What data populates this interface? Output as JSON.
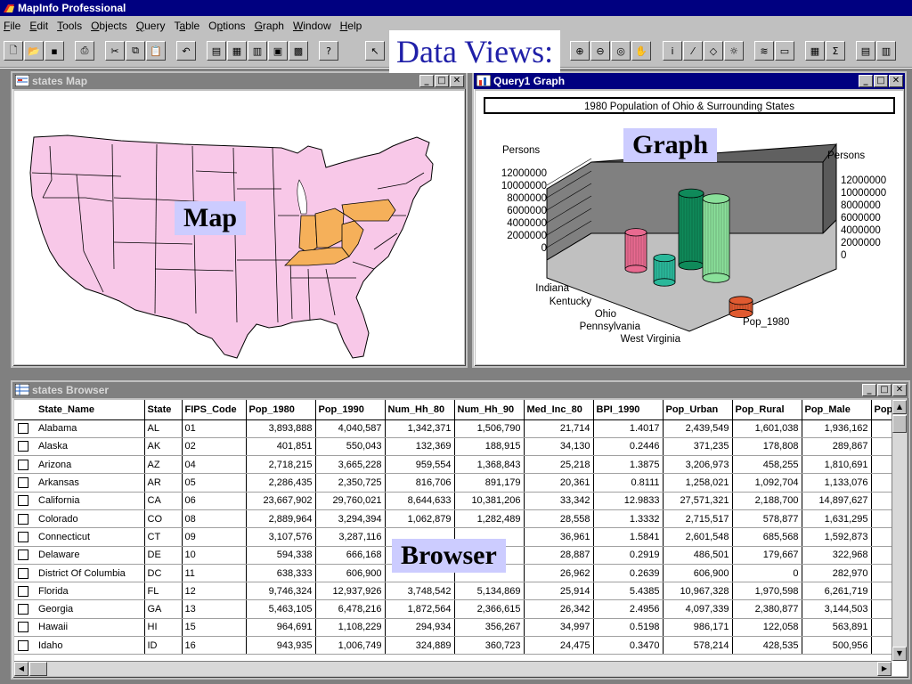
{
  "app": {
    "title": "MapInfo Professional"
  },
  "menu": [
    {
      "pre": "",
      "u": "F",
      "post": "ile"
    },
    {
      "pre": "",
      "u": "E",
      "post": "dit"
    },
    {
      "pre": "",
      "u": "T",
      "post": "ools"
    },
    {
      "pre": "",
      "u": "O",
      "post": "bjects"
    },
    {
      "pre": "",
      "u": "Q",
      "post": "uery"
    },
    {
      "pre": "T",
      "u": "a",
      "post": "ble"
    },
    {
      "pre": "O",
      "u": "p",
      "post": "tions"
    },
    {
      "pre": "",
      "u": "G",
      "post": "raph"
    },
    {
      "pre": "",
      "u": "W",
      "post": "indow"
    },
    {
      "pre": "",
      "u": "H",
      "post": "elp"
    }
  ],
  "callouts": {
    "title": "Data Views:",
    "map": "Map",
    "graph": "Graph",
    "browser": "Browser"
  },
  "map_window": {
    "title": "states Map",
    "highlight_color": "#f5b05a",
    "state_color": "#f8c8e8"
  },
  "graph_window": {
    "title": "Query1 Graph",
    "chart_data": {
      "type": "bar",
      "title": "1980 Population of Ohio & Surrounding States",
      "categories": [
        "Indiana",
        "Kentucky",
        "Ohio",
        "Pennsylvania",
        "West Virginia"
      ],
      "series": [
        {
          "name": "Pop_1980",
          "values": [
            5490224,
            3660777,
            10797630,
            11863895,
            1949644
          ]
        }
      ],
      "ylabel": "Persons",
      "ylim": [
        0,
        12000000
      ],
      "yticks": [
        "12000000",
        "10000000",
        "8000000",
        "6000000",
        "4000000",
        "2000000",
        "0"
      ],
      "colors": [
        "#e86a90",
        "#2ab89a",
        "#0f8a5a",
        "#8ae09a",
        "#e05a30"
      ],
      "bar_style": "3d-cylinder",
      "legend": "none"
    }
  },
  "browser": {
    "title": "states Browser",
    "columns": [
      "State_Name",
      "State",
      "FIPS_Code",
      "Pop_1980",
      "Pop_1990",
      "Num_Hh_80",
      "Num_Hh_90",
      "Med_Inc_80",
      "BPI_1990",
      "Pop_Urban",
      "Pop_Rural",
      "Pop_Male",
      "Pop"
    ],
    "rows": [
      [
        "Alabama",
        "AL",
        "01",
        "3,893,888",
        "4,040,587",
        "1,342,371",
        "1,506,790",
        "21,714",
        "1.4017",
        "2,439,549",
        "1,601,038",
        "1,936,162",
        ""
      ],
      [
        "Alaska",
        "AK",
        "02",
        "401,851",
        "550,043",
        "132,369",
        "188,915",
        "34,130",
        "0.2446",
        "371,235",
        "178,808",
        "289,867",
        ""
      ],
      [
        "Arizona",
        "AZ",
        "04",
        "2,718,215",
        "3,665,228",
        "959,554",
        "1,368,843",
        "25,218",
        "1.3875",
        "3,206,973",
        "458,255",
        "1,810,691",
        ""
      ],
      [
        "Arkansas",
        "AR",
        "05",
        "2,286,435",
        "2,350,725",
        "816,706",
        "891,179",
        "20,361",
        "0.8111",
        "1,258,021",
        "1,092,704",
        "1,133,076",
        ""
      ],
      [
        "California",
        "CA",
        "06",
        "23,667,902",
        "29,760,021",
        "8,644,633",
        "10,381,206",
        "33,342",
        "12.9833",
        "27,571,321",
        "2,188,700",
        "14,897,627",
        ""
      ],
      [
        "Colorado",
        "CO",
        "08",
        "2,889,964",
        "3,294,394",
        "1,062,879",
        "1,282,489",
        "28,558",
        "1.3332",
        "2,715,517",
        "578,877",
        "1,631,295",
        ""
      ],
      [
        "Connecticut",
        "CT",
        "09",
        "3,107,576",
        "3,287,116",
        "",
        "",
        "36,961",
        "1.5841",
        "2,601,548",
        "685,568",
        "1,592,873",
        ""
      ],
      [
        "Delaware",
        "DE",
        "10",
        "594,338",
        "666,168",
        "",
        "",
        "28,887",
        "0.2919",
        "486,501",
        "179,667",
        "322,968",
        ""
      ],
      [
        "District Of Columbia",
        "DC",
        "11",
        "638,333",
        "606,900",
        "",
        "",
        "26,962",
        "0.2639",
        "606,900",
        "0",
        "282,970",
        ""
      ],
      [
        "Florida",
        "FL",
        "12",
        "9,746,324",
        "12,937,926",
        "3,748,542",
        "5,134,869",
        "25,914",
        "5.4385",
        "10,967,328",
        "1,970,598",
        "6,261,719",
        ""
      ],
      [
        "Georgia",
        "GA",
        "13",
        "5,463,105",
        "6,478,216",
        "1,872,564",
        "2,366,615",
        "26,342",
        "2.4956",
        "4,097,339",
        "2,380,877",
        "3,144,503",
        ""
      ],
      [
        "Hawaii",
        "HI",
        "15",
        "964,691",
        "1,108,229",
        "294,934",
        "356,267",
        "34,997",
        "0.5198",
        "986,171",
        "122,058",
        "563,891",
        ""
      ],
      [
        "Idaho",
        "ID",
        "16",
        "943,935",
        "1,006,749",
        "324,889",
        "360,723",
        "24,475",
        "0.3470",
        "578,214",
        "428,535",
        "500,956",
        ""
      ]
    ]
  }
}
